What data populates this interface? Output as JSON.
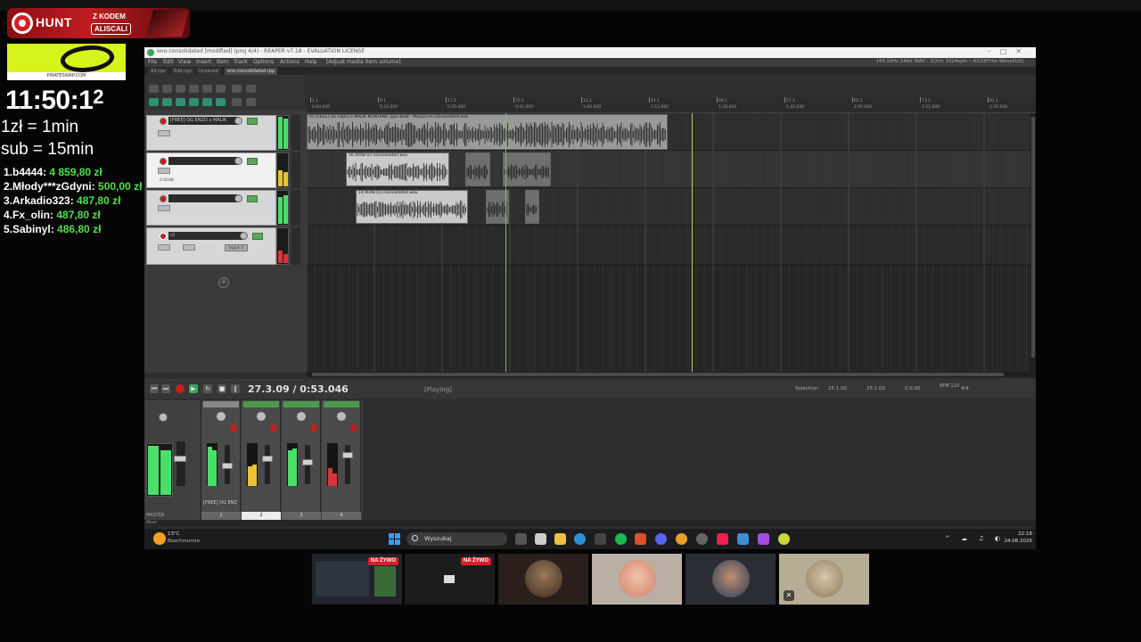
{
  "overlay": {
    "brand": "HUNT",
    "promo_title": "Z KODEM",
    "promo_code": "ALISCALI",
    "sponsor_site": "PIRATESWAP.COM",
    "timer_main": "11:50:1",
    "timer_tail": "2",
    "rate_zl": "1zł = 1min",
    "rate_sub": "sub = 15min",
    "donors": [
      {
        "name": "1.b4444:",
        "amount": "4 859,80 zł"
      },
      {
        "name": "2.Młody***zGdyni:",
        "amount": "500,00 zł"
      },
      {
        "name": "3.Arkadio323:",
        "amount": "487,80 zł"
      },
      {
        "name": "4.Fx_olin:",
        "amount": "487,80 zł"
      },
      {
        "name": "5.Sabinyl:",
        "amount": "486,80 zł"
      }
    ]
  },
  "reaper": {
    "title": "eno-consolidated [modified] (proj 4/4) - REAPER v7.18 - EVALUATION LICENSE",
    "menu": [
      "File",
      "Edit",
      "View",
      "Insert",
      "Item",
      "Track",
      "Options",
      "Actions",
      "Help",
      "[Adjust media item volume]"
    ],
    "status_right": "[44.1kHz 24bit WAV : 2/2ch 1024spls ~43/187ms WaveOut]",
    "tabs": [
      "A3.rpp",
      "Edit.rpp",
      "Unsaved",
      "eno-consolidated.rpp"
    ],
    "tracks": [
      {
        "name": "[FREE] OG ENZO x MALIK",
        "vol": "0.00dB"
      },
      {
        "name": "",
        "vol": "0.00dB"
      },
      {
        "name": "",
        "vol": ""
      },
      {
        "name": "r2",
        "vol": "",
        "input": "Input 1"
      }
    ],
    "items": [
      {
        "label": "01 [FREE] OG ENZO x MALIK MONTANA Type Beat - MAZZETA-consolidated.wav"
      },
      {
        "label": "16.40dB 03 consolidated.wav"
      },
      {
        "label": "14.90dB 03 consolidated.wav"
      }
    ],
    "ruler_labels": [
      "1.1",
      "9.1",
      "17.1",
      "25.1",
      "33.1",
      "41.1",
      "49.1",
      "57.1",
      "65.1",
      "73.1",
      "81.1"
    ],
    "ruler_times": [
      "0:00.000",
      "0:15.000",
      "0:30.000",
      "0:45.000",
      "1:00.000",
      "1:15.000",
      "1:30.000",
      "1:45.000",
      "2:00.000",
      "2:15.000",
      "2:30.000"
    ],
    "time_display": "27.3.09 / 0:53.046",
    "play_state": "[Playing]",
    "selection": {
      "label": "Selection:",
      "start": "25.1.00",
      "end": "25.1.00",
      "length": "0.0.00"
    },
    "bpm": "BPM 120",
    "timesig": "4/4",
    "mixer_strip_name": "[FREE] OG ENZ",
    "mixer_numbers": [
      "1",
      "2",
      "3",
      "4"
    ],
    "master_label": "MASTER",
    "mixer_tab": "Mixer"
  },
  "taskbar": {
    "temp": "13°C",
    "weather": "Bezchmurnie",
    "search": "Wyszukaj",
    "time": "22:18",
    "date": "24.08.2026",
    "tray": "^ ☁ ♫ ◐"
  },
  "cams": [
    {
      "live": "NA ŻYWO"
    },
    {
      "live": "NA ŻYWO"
    }
  ],
  "colors": {
    "donor_amount": "#52e04b",
    "reaper_green": "#3aa35a",
    "rec_red": "#c21f1f",
    "live_red": "#d61f2a"
  }
}
